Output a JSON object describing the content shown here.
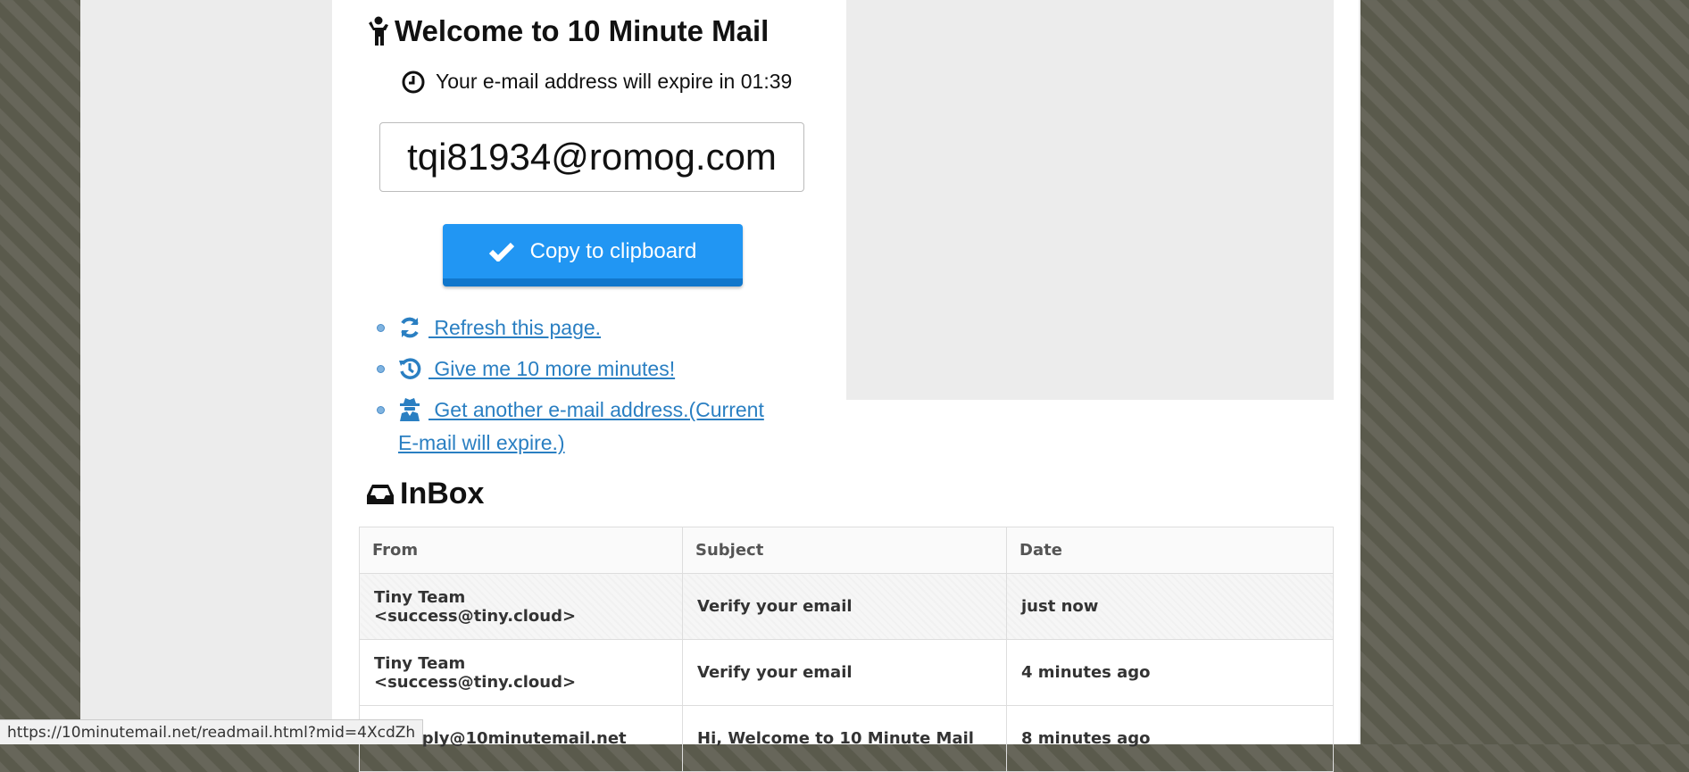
{
  "header": {
    "title": "Welcome to 10 Minute Mail",
    "expire_text": "Your e-mail address will expire in 01:39"
  },
  "email": {
    "address": "tqi81934@romog.com"
  },
  "actions": {
    "copy_label": "Copy to clipboard",
    "links": [
      {
        "label": " Refresh this page.",
        "icon": "refresh-icon"
      },
      {
        "label": " Give me 10 more minutes!",
        "icon": "history-icon"
      },
      {
        "label": " Get another e-mail address.(Current E-mail will expire.)",
        "icon": "user-secret-icon"
      }
    ]
  },
  "inbox": {
    "title": "InBox",
    "columns": [
      "From",
      "Subject",
      "Date"
    ],
    "rows": [
      {
        "from": "Tiny Team <success@tiny.cloud>",
        "subject": "Verify your email",
        "date": "just now"
      },
      {
        "from": "Tiny Team <success@tiny.cloud>",
        "subject": "Verify your email",
        "date": "4 minutes ago"
      },
      {
        "from": "no-reply@10minutemail.net",
        "subject": "Hi, Welcome to 10 Minute Mail",
        "date": "8 minutes ago"
      }
    ]
  },
  "status_bar": {
    "url": "https://10minutemail.net/readmail.html?mid=4XcdZh"
  },
  "colors": {
    "accent": "#2196f3",
    "link": "#2a7fc2",
    "background_stripes": "#5e5d50"
  }
}
